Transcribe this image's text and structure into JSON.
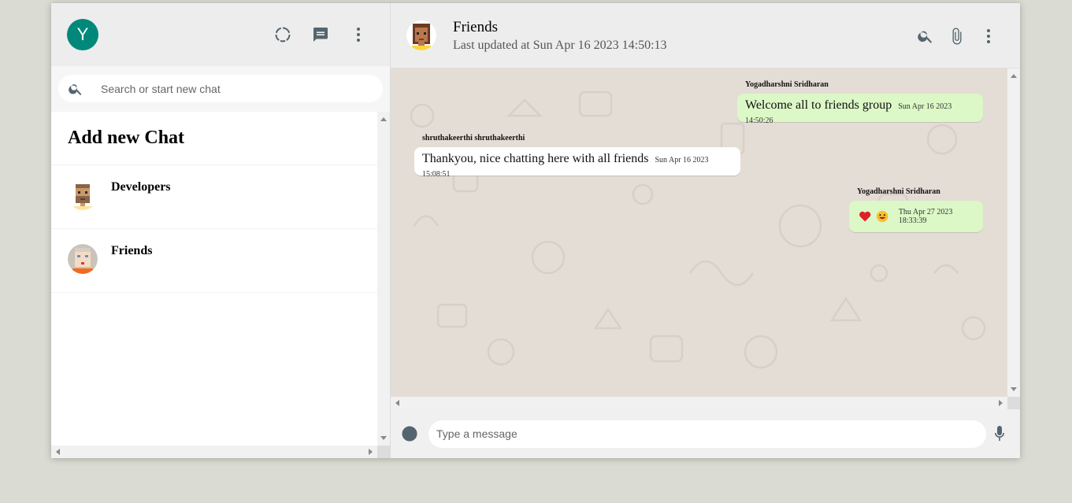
{
  "sidebar": {
    "avatar_initial": "Y",
    "icons": [
      "status-icon",
      "new-chat-icon",
      "menu-icon"
    ],
    "search_placeholder": "Search or start new chat",
    "add_new_chat": "Add new Chat",
    "chats": [
      {
        "name": "Developers"
      },
      {
        "name": "Friends"
      }
    ]
  },
  "chat": {
    "title": "Friends",
    "subtitle": "Last updated at Sun Apr 16 2023 14:50:13",
    "icons": [
      "search-icon",
      "attach-icon",
      "menu-icon"
    ],
    "messages": [
      {
        "sender": "Yogadharshni Sridharan",
        "text": "Welcome all to friends group",
        "time": "Sun Apr 16 2023 14:50:26",
        "type": "sent"
      },
      {
        "sender": "shruthakeerthi shruthakeerthi",
        "text": "Thankyou, nice chatting here with all friends",
        "time": "Sun Apr 16 2023 15:08:51",
        "type": "received"
      },
      {
        "sender": "Yogadharshni Sridharan",
        "text": "",
        "emojis": [
          "heart",
          "grinning-face"
        ],
        "time": "Thu Apr 27 2023 18:33:39",
        "type": "sent"
      }
    ],
    "input_placeholder": "Type a message"
  },
  "colors": {
    "avatar_bg": "#00897b",
    "sent_bubble": "#dcf8c6",
    "received_bubble": "#ffffff",
    "chat_bg": "#e4ddd6",
    "header_bg": "#ededed"
  }
}
